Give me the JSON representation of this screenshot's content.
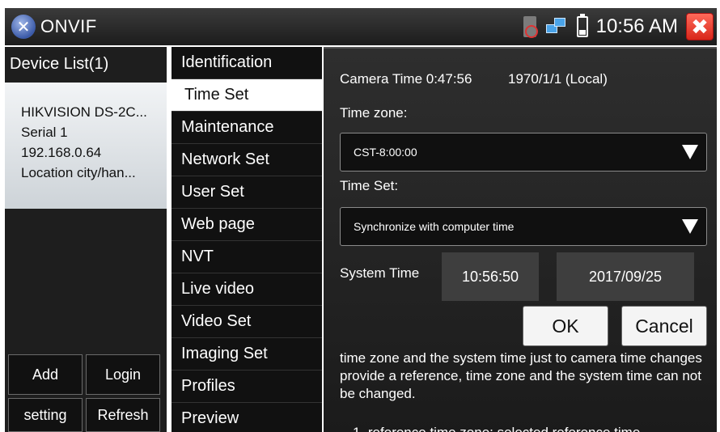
{
  "titlebar": {
    "title": "ONVIF",
    "app_icon_glyph": "✕",
    "icons": [
      "sd-card-icon",
      "network-icon",
      "battery-icon"
    ],
    "time": "10:56 AM",
    "close_glyph": "✖",
    "close_color": "#e8392b"
  },
  "left_panel": {
    "header": "Device List(1)",
    "device": {
      "name": "HIKVISION DS-2C...",
      "serial": "Serial  1",
      "ip": "192.168.0.64",
      "location": "Location  city/han..."
    },
    "buttons": {
      "add": "Add",
      "login": "Login",
      "setting": "setting",
      "refresh": "Refresh"
    }
  },
  "menu": {
    "items": [
      "Identification",
      "Time Set",
      "Maintenance",
      "Network Set",
      "User Set",
      "Web page",
      "NVT",
      "Live video",
      "Video Set",
      "Imaging Set",
      "Profiles",
      "Preview"
    ],
    "selected": "Time Set"
  },
  "content": {
    "camera_time_label": "Camera Time 0:47:56",
    "camera_date": "1970/1/1 (Local)",
    "timezone_label": "Time zone:",
    "timezone_value": "CST-8:00:00",
    "timeset_label": "Time Set:",
    "timeset_value": "Synchronize with computer time",
    "system_time_label": "System Time",
    "system_time": "10:56:50",
    "system_date": "2017/09/25",
    "ok_label": "OK",
    "cancel_label": "Cancel",
    "info_text": "time zone and the system time just to camera time changes provide a reference, time zone and the system time can not be changed.",
    "info_text_2": "1. reference time zone: selected reference time"
  }
}
